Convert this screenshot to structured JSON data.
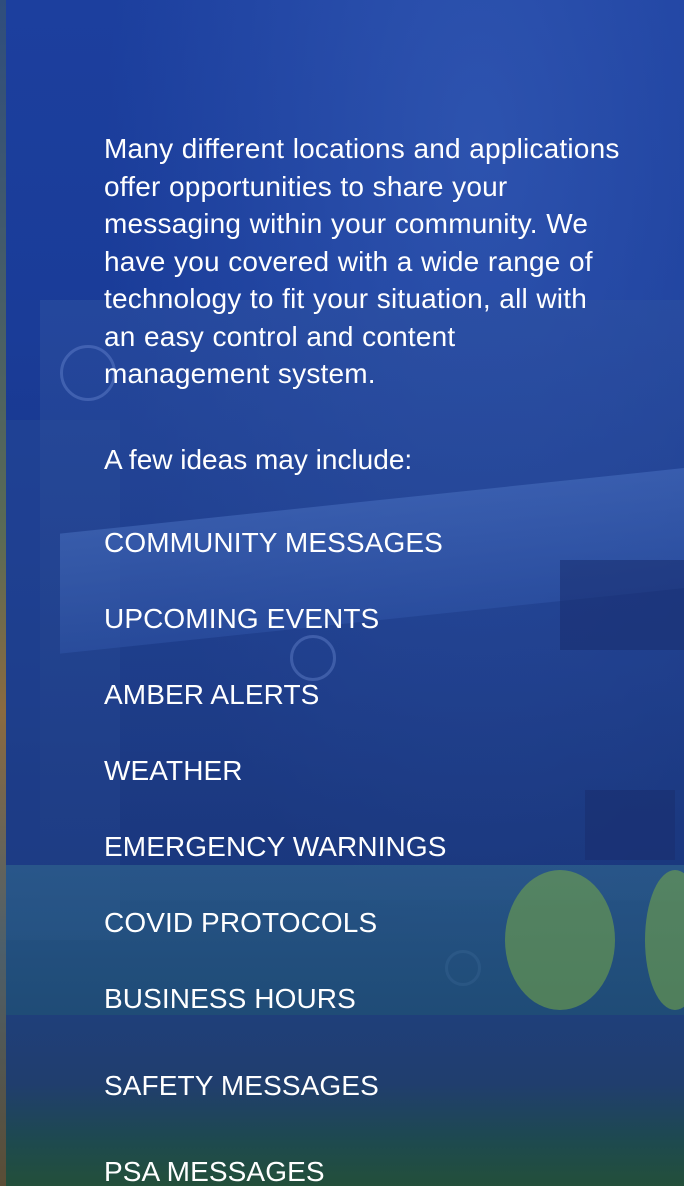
{
  "intro_text": "Many different locations and applications offer opportunities to share your messaging within your community. We have you covered with a wide range of technology to fit your situation, all with an easy control and content management system.",
  "lead_text": "A few ideas may include:",
  "ideas": [
    "COMMUNITY MESSAGES",
    "UPCOMING EVENTS",
    "AMBER ALERTS",
    "WEATHER",
    "EMERGENCY WARNINGS",
    "COVID PROTOCOLS",
    "BUSINESS HOURS",
    "SAFETY MESSAGES",
    "PSA MESSAGES"
  ],
  "colors": {
    "overlay": "#1a3c98",
    "text": "#ffffff"
  }
}
